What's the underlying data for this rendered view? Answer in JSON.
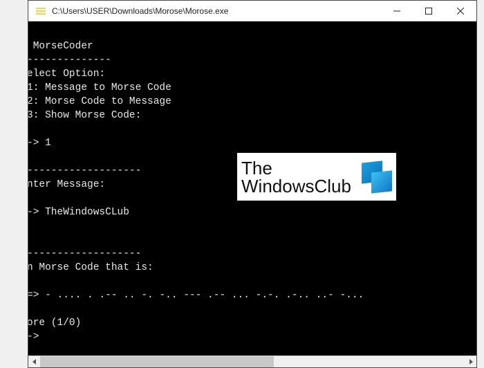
{
  "titlebar": {
    "path": "C:\\Users\\USER\\Downloads\\Morose\\Morose.exe",
    "minimize_glyph": "—",
    "maximize_glyph": "☐",
    "close_glyph": "✕"
  },
  "console": {
    "lines": [
      "",
      " MorseCoder",
      "--------------",
      "elect Option:",
      "1: Message to Morse Code",
      "2: Morse Code to Message",
      "3: Show Morse Code:",
      "",
      "-> 1",
      "",
      "-------------------",
      "nter Message:",
      "",
      "-> TheWindowsCLub",
      "",
      "",
      "-------------------",
      "n Morse Code that is:",
      "",
      "=> - .... . .-- .. -. -.. --- .-- ... -.-. .-.. ..- -...",
      "",
      "ore (1/0)",
      "->"
    ]
  },
  "watermark": {
    "line1": "The",
    "line2": "WindowsClub"
  },
  "scrollbar": {
    "left_glyph": "◀",
    "right_glyph": "▶"
  }
}
